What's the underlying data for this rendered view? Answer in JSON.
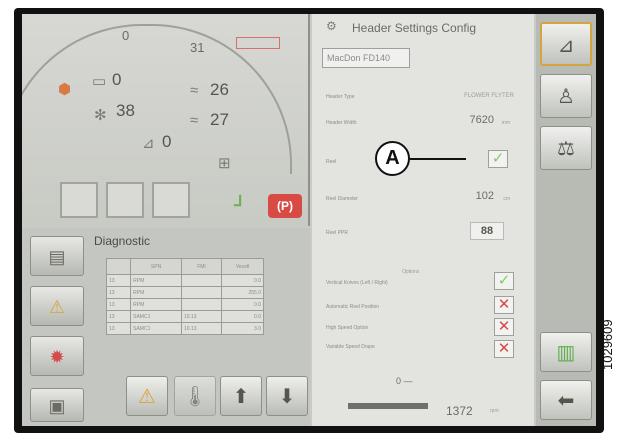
{
  "dashboard": {
    "gauges": {
      "top_left": "0",
      "top_center": "31",
      "left_upper": "0",
      "left_lower": "38",
      "right_upper": "26",
      "right_lower": "27",
      "bottom": "0"
    },
    "parking_brake_label": "(P)"
  },
  "diagnostic": {
    "title": "Diagnostic",
    "columns": [
      "SPN",
      "FMI",
      "Vecell"
    ],
    "rows": [
      {
        "id": "13",
        "name": "RPM",
        "c2": "",
        "value": "0.0"
      },
      {
        "id": "13",
        "name": "RPM",
        "c2": "",
        "value": "255.0"
      },
      {
        "id": "13",
        "name": "RPM",
        "c2": "",
        "value": "0.0"
      },
      {
        "id": "13",
        "name": "SAMC1",
        "c2": "10.13",
        "value": "0.0"
      },
      {
        "id": "13",
        "name": "SAMC1",
        "c2": "10.13",
        "value": "3.0"
      }
    ]
  },
  "settings": {
    "title": "Header Settings Config",
    "header_model": "MacDon FD140",
    "header_type_label": "Header Type",
    "header_type_value": "FLOWER FLYTER",
    "header_width_label": "Header Width",
    "header_width_value": "7620",
    "header_width_unit": "mm",
    "reel_label": "Reel",
    "reel_diameter_label": "Reel Diameter",
    "reel_diameter_value": "102",
    "reel_diameter_unit": "cm",
    "reel_ppr_label": "Reel PPR",
    "reel_ppr_value": "88",
    "options_label": "Options",
    "options": [
      {
        "label": "Vertical Knives (Left / Right)",
        "state": "check"
      },
      {
        "label": "Automatic Reel Position",
        "state": "cross"
      },
      {
        "label": "High Speed Option",
        "state": "cross"
      },
      {
        "label": "Variable Speed Drape",
        "state": "cross"
      }
    ],
    "slider_zero": "0 —",
    "reel_speed": "1372",
    "reel_speed_unit": "rpm"
  },
  "callout": {
    "letter": "A"
  },
  "figure_id": "1029609",
  "icons": {
    "header_config": "header-tilt-icon",
    "operator": "operator-icon",
    "balance": "balance-icon",
    "diag_module": "module-icon",
    "warning_settings": "warning-settings-icon",
    "fault": "fault-icon",
    "machine": "machine-icon",
    "warning": "warning-icon",
    "thermometer": "thermometer-icon",
    "arrow_up": "arrow-up-icon",
    "arrow_down": "arrow-down-icon",
    "service": "service-icon",
    "back": "back-arrow-icon"
  }
}
